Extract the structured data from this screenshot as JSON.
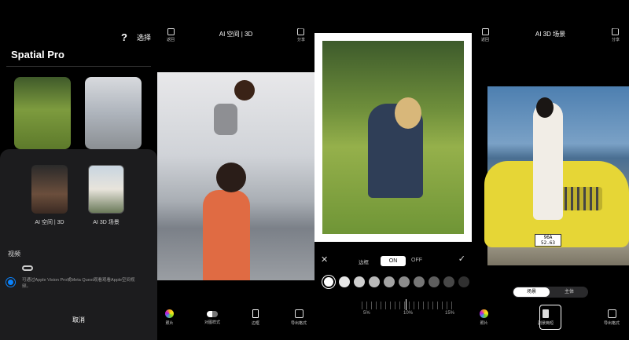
{
  "panel1": {
    "help_icon": "?",
    "select_label": "选择",
    "title": "Spatial Pro",
    "options": [
      {
        "label": "AI 空间 | 3D"
      },
      {
        "label": "AI 3D 场景"
      }
    ],
    "video_label": "视频",
    "description": "可通过Apple Vision Pro或Meta Quest观看观看Apple空间视频。",
    "cancel_label": "取消"
  },
  "panel2": {
    "title": "AI 空间 | 3D",
    "header_left": "返回",
    "header_right": "分享",
    "bottom": [
      {
        "label": "照片",
        "icon": "photos-icon"
      },
      {
        "label": "对图样式",
        "icon": "toggle-icon"
      },
      {
        "label": "边框",
        "icon": "frame-icon"
      },
      {
        "label": "导出格式",
        "icon": "export-icon"
      }
    ]
  },
  "panel3": {
    "close_icon": "✕",
    "frame_label": "边框",
    "on_label": "ON",
    "off_label": "OFF",
    "confirm_icon": "✓",
    "swatches": [
      "#ffffff",
      "#e6e6e6",
      "#cfcfcf",
      "#b9b9b9",
      "#a3a3a3",
      "#8c8c8c",
      "#767676",
      "#5e5e5e",
      "#474747",
      "#303030"
    ],
    "scale": [
      "5%",
      "10%",
      "15%"
    ]
  },
  "panel4": {
    "title": "AI 3D 场景",
    "header_left": "返回",
    "header_right": "分享",
    "plate": "96A\n52.63",
    "seg_a": "场景",
    "seg_b": "主体",
    "bottom": [
      {
        "label": "照片",
        "icon": "photos-icon"
      },
      {
        "label": "副景簡短",
        "icon": "background-icon"
      },
      {
        "label": "导出格式",
        "icon": "export-icon"
      }
    ]
  }
}
